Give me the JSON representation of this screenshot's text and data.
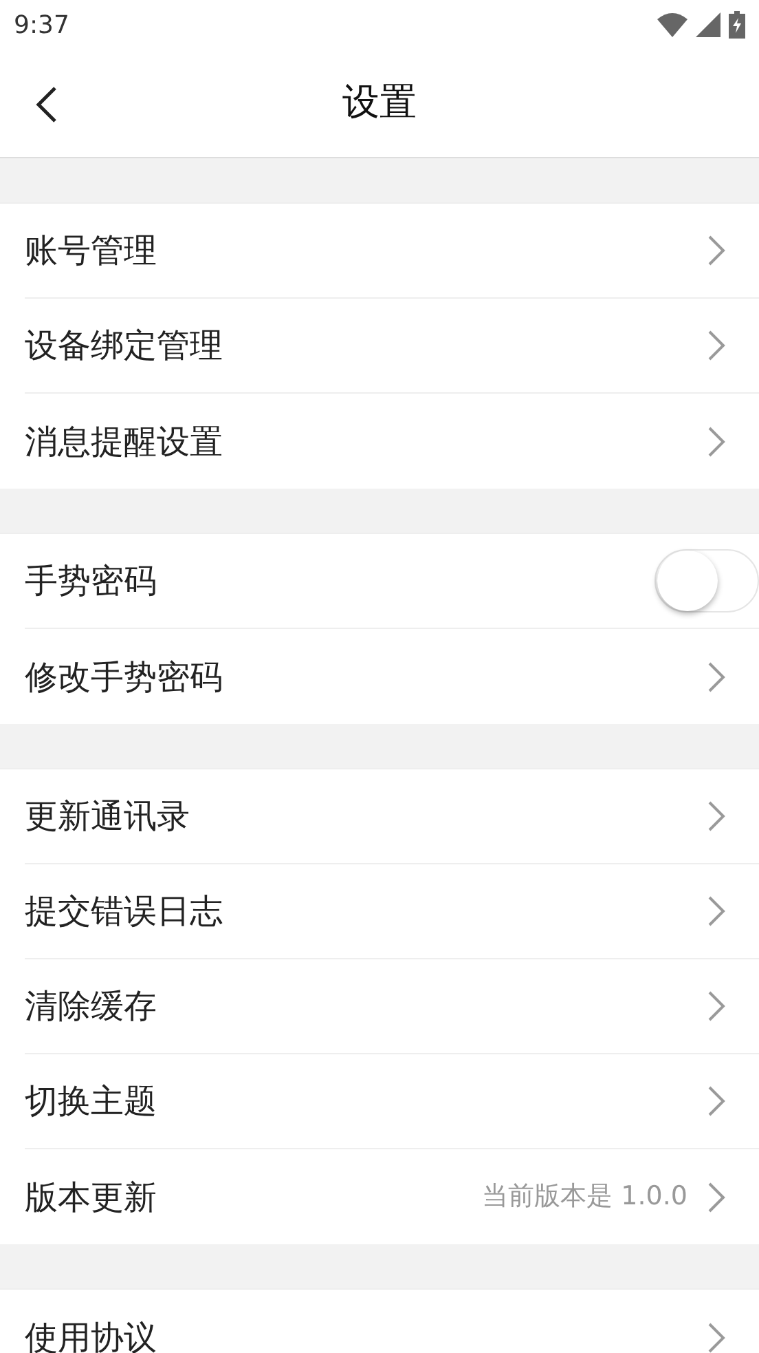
{
  "status_bar": {
    "time": "9:37"
  },
  "header": {
    "title": "设置"
  },
  "sections": [
    {
      "items": [
        {
          "kind": "link",
          "label": "账号管理"
        },
        {
          "kind": "link",
          "label": "设备绑定管理"
        },
        {
          "kind": "link",
          "label": "消息提醒设置"
        }
      ]
    },
    {
      "items": [
        {
          "kind": "toggle",
          "label": "手势密码",
          "on": false
        },
        {
          "kind": "link",
          "label": "修改手势密码"
        }
      ]
    },
    {
      "items": [
        {
          "kind": "link",
          "label": "更新通讯录"
        },
        {
          "kind": "link",
          "label": "提交错误日志"
        },
        {
          "kind": "link",
          "label": "清除缓存"
        },
        {
          "kind": "link",
          "label": "切换主题"
        },
        {
          "kind": "link",
          "label": "版本更新",
          "value": "当前版本是 1.0.0"
        }
      ]
    },
    {
      "items": [
        {
          "kind": "link",
          "label": "使用协议"
        }
      ]
    }
  ]
}
